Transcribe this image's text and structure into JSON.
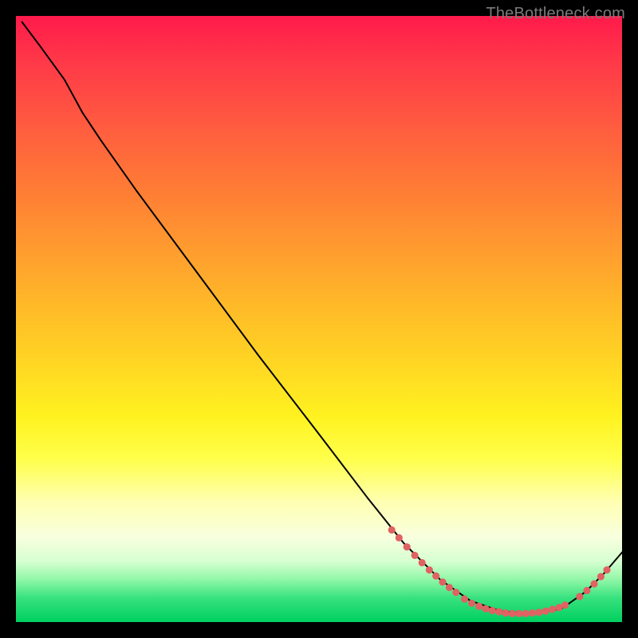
{
  "watermark": "TheBottleneck.com",
  "chart_data": {
    "type": "line",
    "title": "",
    "xlabel": "",
    "ylabel": "",
    "xlim": [
      0,
      100
    ],
    "ylim": [
      0,
      100
    ],
    "grid": false,
    "legend": false,
    "curve": {
      "name": "bottleneck-curve",
      "color": "#000000",
      "points": [
        {
          "x": 1,
          "y": 99.0
        },
        {
          "x": 4,
          "y": 95.0
        },
        {
          "x": 8,
          "y": 89.5
        },
        {
          "x": 11,
          "y": 84.0
        },
        {
          "x": 14,
          "y": 79.5
        },
        {
          "x": 20,
          "y": 71.0
        },
        {
          "x": 30,
          "y": 57.5
        },
        {
          "x": 40,
          "y": 44.0
        },
        {
          "x": 50,
          "y": 31.0
        },
        {
          "x": 58,
          "y": 20.5
        },
        {
          "x": 64,
          "y": 13.0
        },
        {
          "x": 70,
          "y": 7.0
        },
        {
          "x": 75,
          "y": 3.5
        },
        {
          "x": 80,
          "y": 1.8
        },
        {
          "x": 85,
          "y": 1.4
        },
        {
          "x": 90,
          "y": 2.2
        },
        {
          "x": 94,
          "y": 5.0
        },
        {
          "x": 97,
          "y": 8.0
        },
        {
          "x": 100,
          "y": 11.5
        }
      ]
    },
    "highlight_dots": {
      "color": "#e06262",
      "radius_estimate": 0.6,
      "clusters": [
        {
          "name": "descending-band",
          "x_range": [
            62,
            73
          ],
          "y_approx_range": [
            15,
            5
          ],
          "count": 12
        },
        {
          "name": "valley-floor",
          "x_range": [
            74,
            90
          ],
          "y_approx_range": [
            1.3,
            2.5
          ],
          "count": 20
        },
        {
          "name": "ascending-band",
          "x_range": [
            93,
            98
          ],
          "y_approx_range": [
            4,
            9
          ],
          "count": 5
        }
      ],
      "points": [
        {
          "x": 62.0,
          "y": 15.2
        },
        {
          "x": 63.2,
          "y": 13.9
        },
        {
          "x": 64.5,
          "y": 12.4
        },
        {
          "x": 65.8,
          "y": 11.0
        },
        {
          "x": 67.0,
          "y": 9.8
        },
        {
          "x": 68.2,
          "y": 8.6
        },
        {
          "x": 69.3,
          "y": 7.6
        },
        {
          "x": 70.4,
          "y": 6.6
        },
        {
          "x": 71.5,
          "y": 5.7
        },
        {
          "x": 72.6,
          "y": 4.9
        },
        {
          "x": 74.0,
          "y": 3.8
        },
        {
          "x": 75.2,
          "y": 3.1
        },
        {
          "x": 76.4,
          "y": 2.6
        },
        {
          "x": 77.5,
          "y": 2.2
        },
        {
          "x": 78.6,
          "y": 1.9
        },
        {
          "x": 79.7,
          "y": 1.7
        },
        {
          "x": 80.8,
          "y": 1.5
        },
        {
          "x": 81.9,
          "y": 1.4
        },
        {
          "x": 83.0,
          "y": 1.4
        },
        {
          "x": 84.1,
          "y": 1.4
        },
        {
          "x": 85.2,
          "y": 1.5
        },
        {
          "x": 86.3,
          "y": 1.6
        },
        {
          "x": 87.4,
          "y": 1.8
        },
        {
          "x": 88.5,
          "y": 2.1
        },
        {
          "x": 89.6,
          "y": 2.4
        },
        {
          "x": 90.6,
          "y": 2.8
        },
        {
          "x": 93.0,
          "y": 4.2
        },
        {
          "x": 94.2,
          "y": 5.2
        },
        {
          "x": 95.4,
          "y": 6.3
        },
        {
          "x": 96.5,
          "y": 7.5
        },
        {
          "x": 97.5,
          "y": 8.6
        }
      ]
    }
  }
}
